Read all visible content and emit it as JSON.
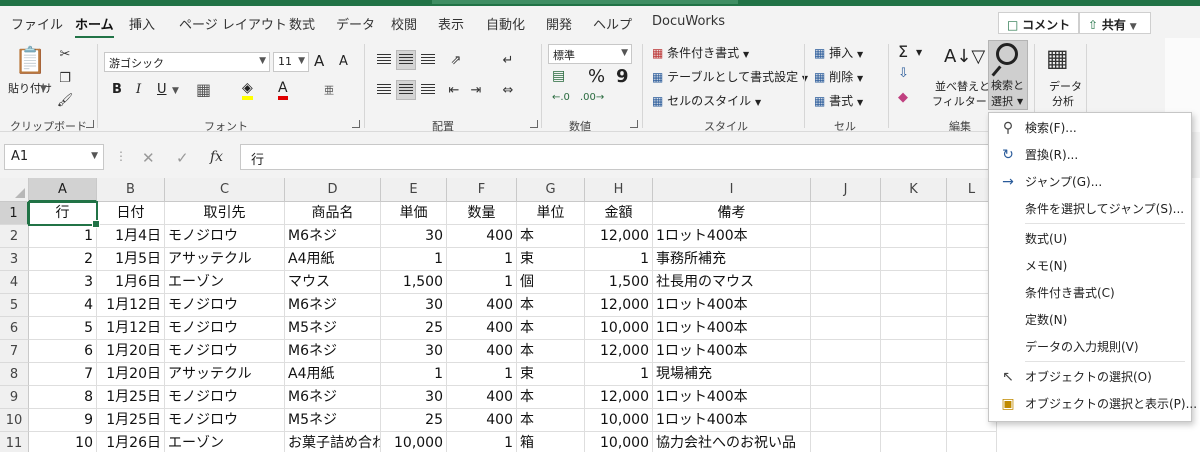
{
  "tabs": [
    "ファイル",
    "ホーム",
    "挿入",
    "ページ レイアウト",
    "数式",
    "データ",
    "校閲",
    "表示",
    "自動化",
    "開発",
    "ヘルプ",
    "DocuWorks"
  ],
  "top_buttons": {
    "comment": "コメント",
    "share": "共有"
  },
  "ribbon": {
    "clipboard": {
      "paste": "貼り付け",
      "label": "クリップボード"
    },
    "font": {
      "name": "游ゴシック",
      "size": "11",
      "bold": "B",
      "italic": "I",
      "underline": "U",
      "grow": "A",
      "shrink": "A",
      "phonetic": "亜",
      "label": "フォント"
    },
    "alignment": {
      "label": "配置"
    },
    "number": {
      "format": "標準",
      "percent": "%",
      "comma": "9",
      "label": "数値"
    },
    "styles": {
      "conditional": "条件付き書式",
      "table": "テーブルとして書式設定",
      "cell": "セルのスタイル",
      "label": "スタイル"
    },
    "cells": {
      "insert": "挿入",
      "delete": "削除",
      "format": "書式",
      "label": "セル"
    },
    "editing": {
      "sum": "Σ",
      "sort_line1": "並べ替えと",
      "sort_line2": "フィルター",
      "find_line1": "検索と",
      "find_line2": "選択",
      "label": "編集"
    },
    "analysis": {
      "line1": "データ",
      "line2": "分析"
    }
  },
  "formula_bar": {
    "name_box": "A1",
    "fx": "fx",
    "value": "行"
  },
  "columns": [
    "A",
    "B",
    "C",
    "D",
    "E",
    "F",
    "G",
    "H",
    "I",
    "J",
    "K",
    "L"
  ],
  "rows": [
    [
      "1",
      "行",
      "日付",
      "取引先",
      "商品名",
      "単価",
      "数量",
      "単位",
      "金額",
      "備考"
    ],
    [
      "2",
      "1",
      "1月4日",
      "モノジロウ",
      "M6ネジ",
      "30",
      "400",
      "本",
      "12,000",
      "1ロット400本"
    ],
    [
      "3",
      "2",
      "1月5日",
      "アサッテクル",
      "A4用紙",
      "1",
      "1",
      "束",
      "1",
      "事務所補充"
    ],
    [
      "4",
      "3",
      "1月6日",
      "エーゾン",
      "マウス",
      "1,500",
      "1",
      "個",
      "1,500",
      "社長用のマウス"
    ],
    [
      "5",
      "4",
      "1月12日",
      "モノジロウ",
      "M6ネジ",
      "30",
      "400",
      "本",
      "12,000",
      "1ロット400本"
    ],
    [
      "6",
      "5",
      "1月12日",
      "モノジロウ",
      "M5ネジ",
      "25",
      "400",
      "本",
      "10,000",
      "1ロット400本"
    ],
    [
      "7",
      "6",
      "1月20日",
      "モノジロウ",
      "M6ネジ",
      "30",
      "400",
      "本",
      "12,000",
      "1ロット400本"
    ],
    [
      "8",
      "7",
      "1月20日",
      "アサッテクル",
      "A4用紙",
      "1",
      "1",
      "束",
      "1",
      "現場補充"
    ],
    [
      "9",
      "8",
      "1月25日",
      "モノジロウ",
      "M6ネジ",
      "30",
      "400",
      "本",
      "12,000",
      "1ロット400本"
    ],
    [
      "10",
      "9",
      "1月25日",
      "モノジロウ",
      "M5ネジ",
      "25",
      "400",
      "本",
      "10,000",
      "1ロット400本"
    ],
    [
      "11",
      "10",
      "1月26日",
      "エーゾン",
      "お菓子詰め合わ",
      "10,000",
      "1",
      "箱",
      "10,000",
      "協力会社へのお祝い品"
    ]
  ],
  "menu": {
    "items": [
      {
        "label": "検索(F)...",
        "icon": "search-icon"
      },
      {
        "label": "置換(R)...",
        "icon": "replace-icon"
      },
      {
        "label": "ジャンプ(G)...",
        "icon": "arrow-right-icon"
      },
      {
        "label": "条件を選択してジャンプ(S)...",
        "icon": ""
      },
      {
        "label": "数式(U)",
        "icon": ""
      },
      {
        "label": "メモ(N)",
        "icon": ""
      },
      {
        "label": "条件付き書式(C)",
        "icon": ""
      },
      {
        "label": "定数(N)",
        "icon": ""
      },
      {
        "label": "データの入力規則(V)",
        "icon": ""
      },
      {
        "label": "オブジェクトの選択(O)",
        "icon": "cursor-icon"
      },
      {
        "label": "オブジェクトの選択と表示(P)...",
        "icon": "selection-pane-icon"
      }
    ]
  }
}
